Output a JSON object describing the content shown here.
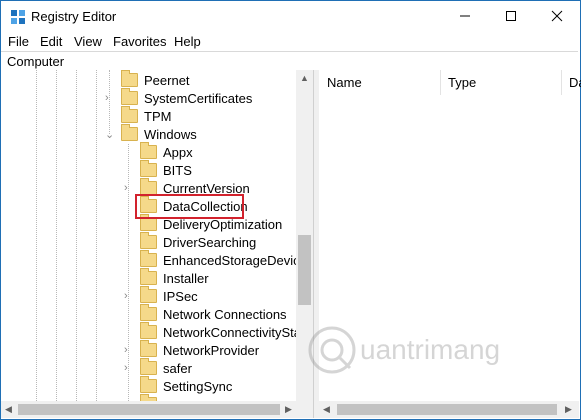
{
  "window": {
    "title": "Registry Editor"
  },
  "menu": {
    "file": "File",
    "edit": "Edit",
    "view": "View",
    "favorites": "Favorites",
    "help": "Help"
  },
  "address": "Computer",
  "tree": {
    "items": [
      {
        "label": "Peernet",
        "expander": ""
      },
      {
        "label": "SystemCertificates",
        "expander": ">"
      },
      {
        "label": "TPM",
        "expander": ""
      },
      {
        "label": "Windows",
        "expander": "v"
      },
      {
        "label": "Appx",
        "expander": ""
      },
      {
        "label": "BITS",
        "expander": ""
      },
      {
        "label": "CurrentVersion",
        "expander": ">"
      },
      {
        "label": "DataCollection",
        "expander": ""
      },
      {
        "label": "DeliveryOptimization",
        "expander": ""
      },
      {
        "label": "DriverSearching",
        "expander": ""
      },
      {
        "label": "EnhancedStorageDevices",
        "expander": ""
      },
      {
        "label": "Installer",
        "expander": ""
      },
      {
        "label": "IPSec",
        "expander": ">"
      },
      {
        "label": "Network Connections",
        "expander": ""
      },
      {
        "label": "NetworkConnectivityStatu",
        "expander": ""
      },
      {
        "label": "NetworkProvider",
        "expander": ">"
      },
      {
        "label": "safer",
        "expander": ">"
      },
      {
        "label": "SettingSync",
        "expander": ""
      }
    ],
    "selected": "DataCollection"
  },
  "columns": {
    "name": "Name",
    "type": "Type",
    "data": "Da"
  },
  "watermark": "uantrimang",
  "colors": {
    "highlight": "#d2222d",
    "folder": "#f5d98a",
    "frame": "#1f6fb5"
  },
  "icons": [
    "registry-editor-icon",
    "minimize-icon",
    "maximize-icon",
    "close-icon",
    "folder-icon",
    "chevron-right-icon",
    "chevron-down-icon"
  ]
}
